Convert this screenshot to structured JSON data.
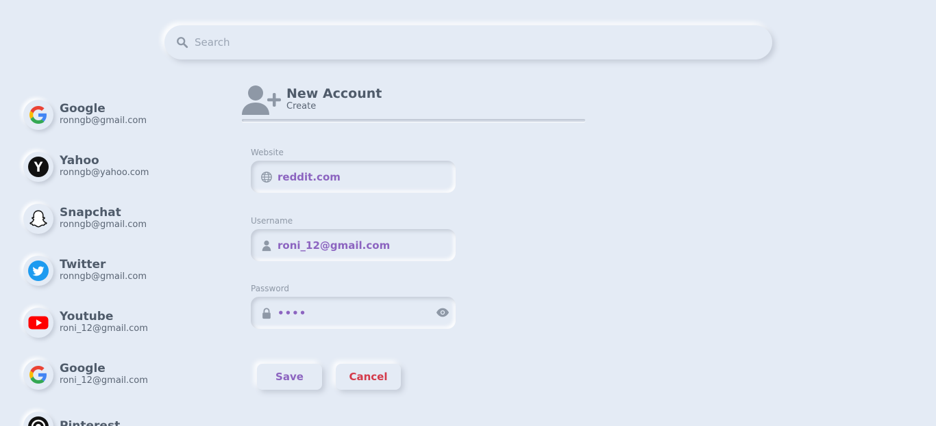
{
  "search": {
    "placeholder": "Search",
    "value": ""
  },
  "sidebar": {
    "accounts": [
      {
        "name": "Google",
        "email": "ronngb@gmail.com",
        "icon": "google-icon"
      },
      {
        "name": "Yahoo",
        "email": "ronngb@yahoo.com",
        "icon": "yahoo-icon"
      },
      {
        "name": "Snapchat",
        "email": "ronngb@gmail.com",
        "icon": "snapchat-icon"
      },
      {
        "name": "Twitter",
        "email": "ronngb@gmail.com",
        "icon": "twitter-icon"
      },
      {
        "name": "Youtube",
        "email": "roni_12@gmail.com",
        "icon": "youtube-icon"
      },
      {
        "name": "Google",
        "email": "roni_12@gmail.com",
        "icon": "google-icon"
      },
      {
        "name": "Pinterest",
        "email": "",
        "icon": "pinterest-icon"
      }
    ]
  },
  "form": {
    "title": "New Account",
    "subtitle": "Create",
    "website": {
      "label": "Website",
      "value": "reddit.com",
      "icon": "globe-icon"
    },
    "username": {
      "label": "Username",
      "value": "roni_12@gmail.com",
      "icon": "user-icon"
    },
    "password": {
      "label": "Password",
      "value": "••••",
      "icon": "lock-icon",
      "toggle_icon": "eye-icon"
    },
    "save_label": "Save",
    "cancel_label": "Cancel"
  },
  "colors": {
    "background": "#e4ebf5",
    "accent": "#8c64c0",
    "danger": "#d43a4a",
    "text": "#4f5b6a"
  }
}
